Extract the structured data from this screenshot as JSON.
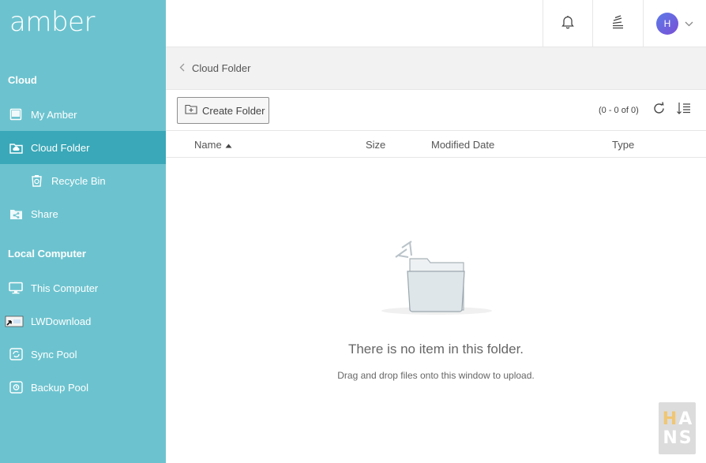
{
  "app": {
    "brand": "amber"
  },
  "sidebar": {
    "sections": [
      {
        "title": "Cloud"
      },
      {
        "title": "Local Computer"
      }
    ],
    "items": [
      {
        "label": "My Amber",
        "icon": "book-icon"
      },
      {
        "label": "Cloud Folder",
        "icon": "cloud-folder-icon",
        "active": true
      },
      {
        "label": "Recycle Bin",
        "icon": "recycle-bin-icon"
      },
      {
        "label": "Share",
        "icon": "share-icon"
      },
      {
        "label": "This Computer",
        "icon": "monitor-icon"
      },
      {
        "label": "LWDownload",
        "icon": "shortcut-folder-icon"
      },
      {
        "label": "Sync Pool",
        "icon": "sync-icon"
      },
      {
        "label": "Backup Pool",
        "icon": "backup-icon"
      }
    ]
  },
  "header": {
    "avatar_initial": "H",
    "icons": [
      "bell-icon",
      "stack-icon",
      "chevron-down-icon"
    ]
  },
  "breadcrumb": {
    "current": "Cloud Folder"
  },
  "toolbar": {
    "create_folder_label": "Create Folder",
    "count_text": "(0 - 0 of 0)"
  },
  "table": {
    "columns": {
      "name": "Name",
      "size": "Size",
      "modified": "Modified Date",
      "type": "Type"
    },
    "sort": {
      "column": "name",
      "direction": "asc"
    }
  },
  "empty_state": {
    "title": "There is no item in this folder.",
    "subtitle": "Drag and drop files onto this window to upload."
  },
  "watermark": {
    "row1": [
      "H",
      "A"
    ],
    "row2": [
      "N",
      "S"
    ]
  },
  "colors": {
    "sidebar_bg": "#6cc3cf",
    "sidebar_active": "#3aa8b8",
    "watermark_accent": "#f0c674"
  }
}
